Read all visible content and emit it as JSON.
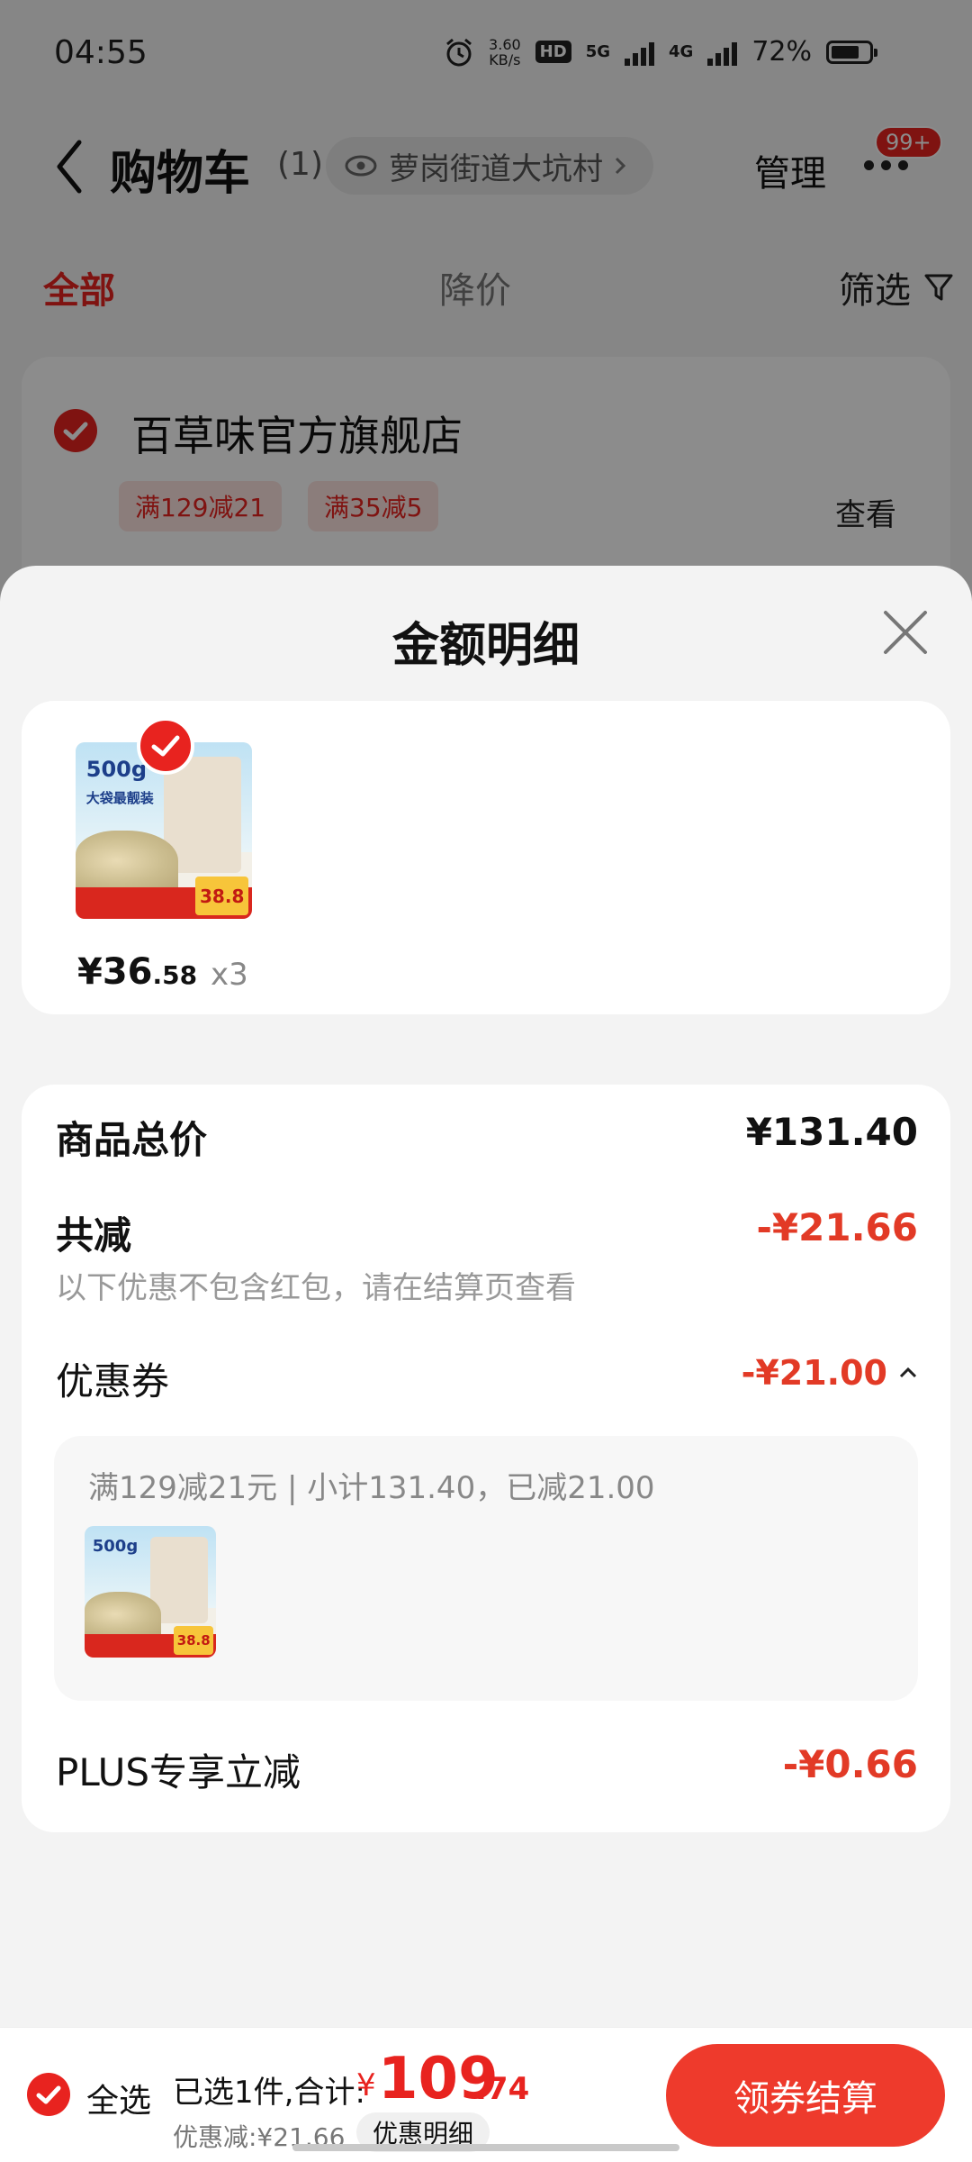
{
  "status_bar": {
    "time": "04:55",
    "speed_value": "3.60",
    "speed_unit": "KB/s",
    "hd_badge": "HD",
    "net_5g": "5G",
    "net_4g": "4G",
    "battery_percent": "72%"
  },
  "nav": {
    "title": "购物车",
    "count": "(1)",
    "location": "萝岗街道大坑村",
    "manage": "管理",
    "badge": "99+"
  },
  "tabs": {
    "all": "全部",
    "price_drop": "降价",
    "filter": "筛选"
  },
  "store": {
    "name": "百草味官方旗舰店",
    "coupons": [
      "满129减21",
      "满35减5"
    ],
    "view": "查看"
  },
  "sheet": {
    "title": "金额明细",
    "product_image": {
      "weight": "500g",
      "tagline": "大袋最靓装",
      "price_tag": "38.8"
    },
    "item": {
      "price_main": "¥36",
      "price_decimal": ".58",
      "quantity": "x3"
    },
    "rows": {
      "goods_total_label": "商品总价",
      "goods_total_value": "¥131.40",
      "total_reduction_label": "共减",
      "total_reduction_value": "-¥21.66",
      "note": "以下优惠不包含红包，请在结算页查看",
      "coupon_label": "优惠券",
      "coupon_value": "-¥21.00",
      "coupon_detail": "满129减21元 | 小计131.40，已减21.00",
      "plus_label": "PLUS专享立减",
      "plus_value": "-¥0.66"
    }
  },
  "bottom_bar": {
    "select_all": "全选",
    "summary": "已选1件,合计:",
    "currency": "¥",
    "total_main": "109",
    "total_decimal": ".74",
    "discount": "优惠减:¥21.66",
    "detail_button": "优惠明细",
    "checkout": "领券结算"
  },
  "colors": {
    "accent_red": "#e8231f",
    "minus_red": "#e23a26",
    "sheet_bg": "#f3f3f3"
  }
}
